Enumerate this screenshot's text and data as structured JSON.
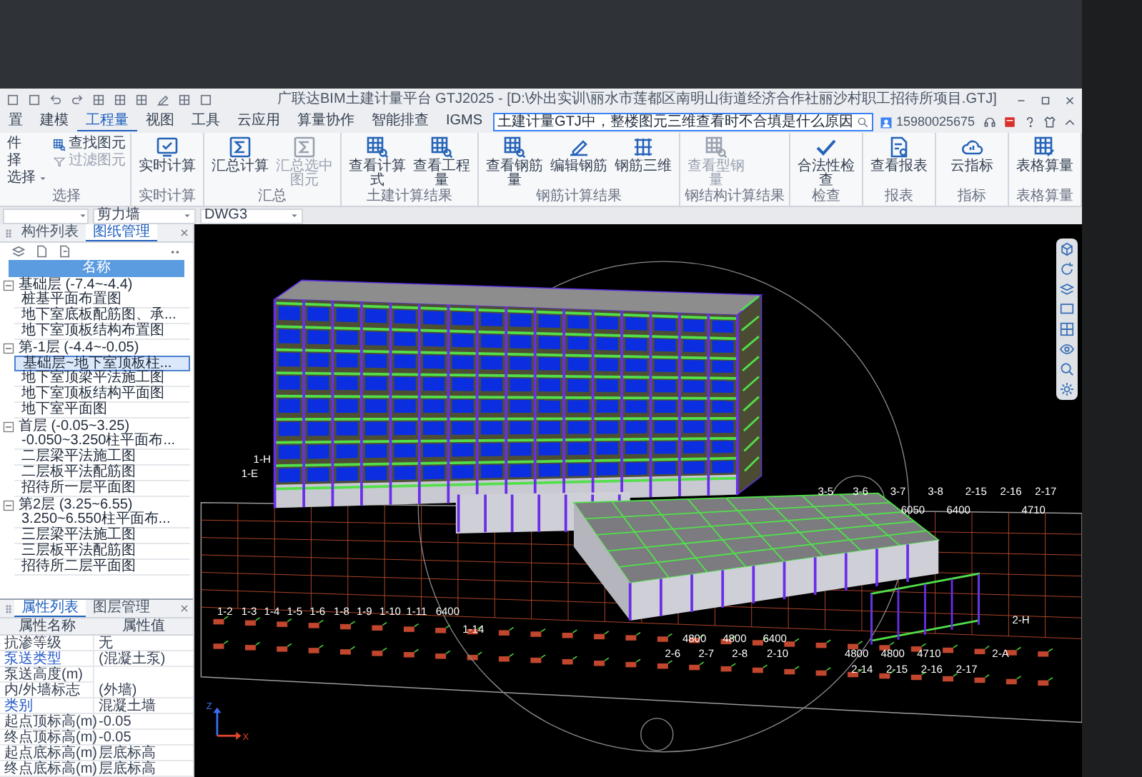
{
  "window": {
    "title": "广联达BIM土建计量平台 GTJ2025 - [D:\\外出实训\\丽水市莲都区南明山街道经济合作社丽沙村职工招待所项目.GTJ]"
  },
  "menu_tabs": [
    {
      "label": "置",
      "selected": false
    },
    {
      "label": "建模",
      "selected": false
    },
    {
      "label": "工程量",
      "selected": true
    },
    {
      "label": "视图",
      "selected": false
    },
    {
      "label": "工具",
      "selected": false
    },
    {
      "label": "云应用",
      "selected": false
    },
    {
      "label": "算量协作",
      "selected": false
    },
    {
      "label": "智能排查",
      "selected": false
    },
    {
      "label": "IGMS",
      "selected": false
    }
  ],
  "help_search": {
    "value": "土建计量GTJ中，整楼图元三维查看时不合填是什么原因"
  },
  "account": {
    "phone": "15980025675"
  },
  "ribbon_groups": [
    {
      "label": "选择",
      "items": [
        {
          "label": "件",
          "kind": "small",
          "disabled": false
        },
        {
          "label": "择",
          "kind": "small",
          "disabled": false
        },
        {
          "label": "选择",
          "kind": "small",
          "disabled": false,
          "dropdown": true
        },
        {
          "label": "查找图元",
          "kind": "small",
          "disabled": false
        },
        {
          "label": "过滤图元",
          "kind": "small",
          "disabled": true
        }
      ]
    },
    {
      "label": "实时计算",
      "items": [
        {
          "label": "实时计算",
          "kind": "large",
          "disabled": false
        }
      ]
    },
    {
      "label": "汇总",
      "items": [
        {
          "label": "汇总计算",
          "kind": "large",
          "disabled": false
        },
        {
          "label": "汇总选中图元",
          "kind": "large",
          "disabled": true
        }
      ]
    },
    {
      "label": "土建计算结果",
      "items": [
        {
          "label": "查看计算式",
          "kind": "large",
          "disabled": false
        },
        {
          "label": "查看工程量",
          "kind": "large",
          "disabled": false
        }
      ]
    },
    {
      "label": "钢筋计算结果",
      "items": [
        {
          "label": "查看钢筋量",
          "kind": "large",
          "disabled": false
        },
        {
          "label": "编辑钢筋",
          "kind": "large",
          "disabled": false
        },
        {
          "label": "钢筋三维",
          "kind": "large",
          "disabled": false
        }
      ]
    },
    {
      "label": "钢结构计算结果",
      "items": [
        {
          "label": "查看型钢量",
          "kind": "large",
          "disabled": true
        }
      ]
    },
    {
      "label": "检查",
      "items": [
        {
          "label": "合法性检查",
          "kind": "large",
          "disabled": false
        }
      ]
    },
    {
      "label": "报表",
      "items": [
        {
          "label": "查看报表",
          "kind": "large",
          "disabled": false
        }
      ]
    },
    {
      "label": "指标",
      "items": [
        {
          "label": "云指标",
          "kind": "large",
          "disabled": false
        }
      ]
    },
    {
      "label": "表格算量",
      "items": [
        {
          "label": "表格算量",
          "kind": "large",
          "disabled": false
        }
      ]
    }
  ],
  "selectors": [
    "剪力墙",
    "DWG3"
  ],
  "left_panel": {
    "tabs": [
      {
        "label": "构件列表",
        "selected": false
      },
      {
        "label": "图纸管理",
        "selected": true
      }
    ],
    "header": "名称",
    "tree": [
      {
        "label": "基础层 (-7.4~-4.4)",
        "expanded": true,
        "children": [
          {
            "label": "桩基平面布置图",
            "selected": false
          },
          {
            "label": "地下室底板配筋图、承...",
            "selected": false
          },
          {
            "label": "地下室顶板结构布置图",
            "selected": false
          }
        ]
      },
      {
        "label": "第-1层 (-4.4~-0.05)",
        "expanded": true,
        "children": [
          {
            "label": "基础层~地下室顶板柱...",
            "selected": true
          },
          {
            "label": "地下室顶梁平法施工图",
            "selected": false
          },
          {
            "label": "地下室顶板结构平面图",
            "selected": false
          },
          {
            "label": "地下室平面图",
            "selected": false
          }
        ]
      },
      {
        "label": "首层 (-0.05~3.25)",
        "expanded": true,
        "children": [
          {
            "label": "-0.050~3.250柱平面布...",
            "selected": false
          },
          {
            "label": "二层梁平法施工图",
            "selected": false
          },
          {
            "label": "二层板平法配筋图",
            "selected": false
          },
          {
            "label": "招待所一层平面图",
            "selected": false
          }
        ]
      },
      {
        "label": "第2层 (3.25~6.55)",
        "expanded": true,
        "children": [
          {
            "label": "3.250~6.550柱平面布...",
            "selected": false
          },
          {
            "label": "三层梁平法施工图",
            "selected": false
          },
          {
            "label": "三层板平法配筋图",
            "selected": false
          },
          {
            "label": "招待所二层平面图",
            "selected": false
          }
        ]
      }
    ]
  },
  "properties": {
    "tabs": [
      {
        "label": "属性列表",
        "selected": true
      },
      {
        "label": "图层管理",
        "selected": false
      }
    ],
    "columns": [
      "属性名称",
      "属性值"
    ],
    "rows": [
      {
        "name": "抗渗等级",
        "value": "无",
        "public": false
      },
      {
        "name": "泵送类型",
        "value": "(混凝土泵)",
        "public": true
      },
      {
        "name": "泵送高度(m)",
        "value": "",
        "public": false
      },
      {
        "name": "内/外墙标志",
        "value": "(外墙)",
        "public": false
      },
      {
        "name": "类别",
        "value": "混凝土墙",
        "public": true
      },
      {
        "name": "起点顶标高(m)",
        "value": "-0.05",
        "public": false
      },
      {
        "name": "终点顶标高(m)",
        "value": "-0.05",
        "public": false
      },
      {
        "name": "起点底标高(m)",
        "value": "层底标高",
        "public": false
      },
      {
        "name": "终点底标高(m)",
        "value": "层底标高",
        "public": false
      }
    ]
  },
  "viewport": {
    "axis_labels": [
      "1-H",
      "1-E",
      "3-5",
      "3-6",
      "3-7",
      "3-8",
      "2-15",
      "2-16",
      "2-17",
      "6050",
      "6400",
      "4710",
      "1-2",
      "1-3",
      "1-4",
      "1-5",
      "1-6",
      "1-8",
      "1-9",
      "1-10",
      "1-11",
      "6400",
      "2-H",
      "1-14",
      "4800",
      "4800",
      "6400",
      "2-6",
      "2-7",
      "2-8",
      "2-10",
      "4800",
      "4800",
      "4710",
      "2-A",
      "2-14",
      "2-15",
      "2-16",
      "2-17"
    ],
    "axis_indicator": {
      "z_label": "Z",
      "x_label": "X"
    }
  }
}
